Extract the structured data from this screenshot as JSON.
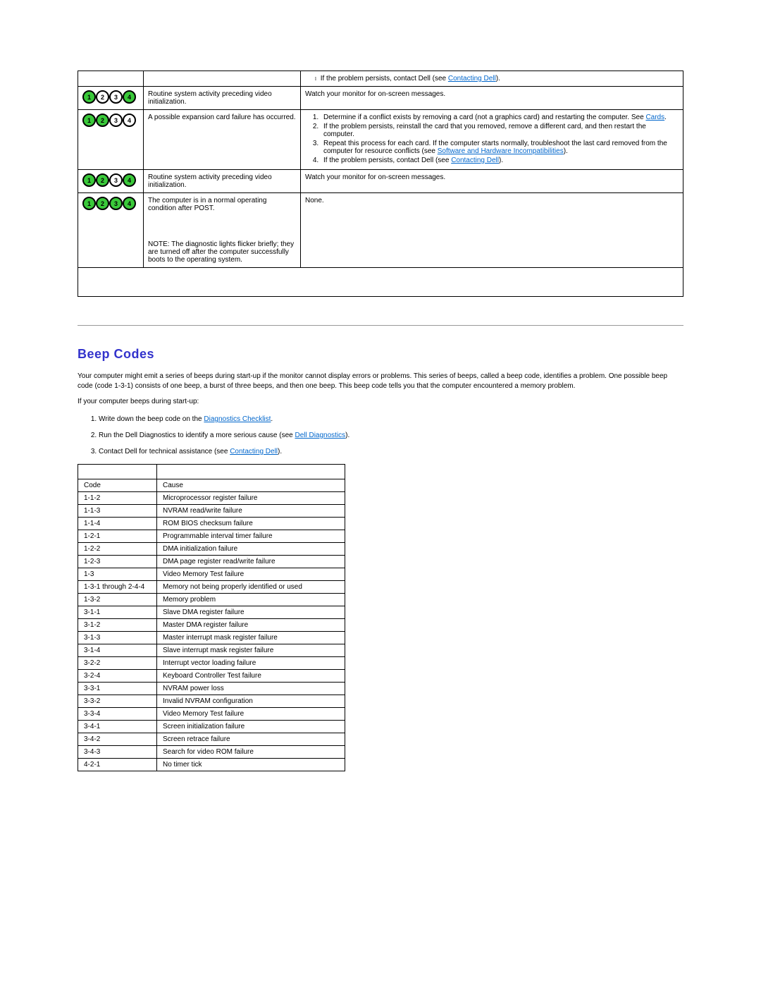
{
  "diag_rows": [
    {
      "pattern": "prev",
      "description": "",
      "solution_type": "bullet_contact"
    },
    {
      "pattern": [
        1,
        0,
        0,
        1
      ],
      "description": "Routine system activity preceding video initialization.",
      "solution_type": "watch_monitor"
    },
    {
      "pattern": [
        1,
        1,
        0,
        0
      ],
      "description": "A possible expansion card failure has occurred.",
      "solution_type": "expansion_steps"
    },
    {
      "pattern": [
        1,
        1,
        0,
        1
      ],
      "description": "Routine system activity preceding video initialization.",
      "solution_type": "watch_monitor"
    },
    {
      "pattern": [
        1,
        1,
        1,
        1
      ],
      "description": "The computer is in a normal operating condition after POST.",
      "note": "NOTE: The diagnostic lights flicker briefly; they are turned off after the computer successfully boots to the operating system.",
      "solution_type": "none"
    }
  ],
  "strings": {
    "watch_monitor": "Watch your monitor for on-screen messages.",
    "none": "None.",
    "contact_dell_prefix": "If the problem persists, contact Dell (see ",
    "contact_dell_link": "Contacting Dell",
    "contact_dell_suffix": ").",
    "exp1_a": "Determine if a conflict exists by removing a card (not a graphics card) and restarting the computer. See ",
    "exp1_link": "Cards",
    "exp1_b": ".",
    "exp2": "If the problem persists, reinstall the card that you removed, remove a different card, and then restart the computer.",
    "exp3_a": "Repeat this process for each card. If the computer starts normally, troubleshoot the last card removed from the computer for resource conflicts (see ",
    "exp3_link": "Software and Hardware Incompatibilities",
    "exp3_b": ").",
    "exp4_a": "If the problem persists, contact Dell (see ",
    "exp4_link": "Contacting Dell",
    "exp4_b": ")."
  },
  "beep_section": {
    "title": "Beep Codes",
    "intro": "Your computer might emit a series of beeps during start-up if the monitor cannot display errors or problems. This series of beeps, called a beep code, identifies a problem. One possible beep code (code 1-3-1) consists of one beep, a burst of three beeps, and then one beep. This beep code tells you that the computer encountered a memory problem.",
    "if_beeps": "If your computer beeps during start-up:",
    "steps": [
      {
        "a": "Write down the beep code on the ",
        "link": "Diagnostics Checklist",
        "b": "."
      },
      {
        "a": "Run the Dell Diagnostics to identify a more serious cause (see ",
        "link": "Dell Diagnostics",
        "b": ")."
      },
      {
        "a": "Contact Dell for technical assistance (see ",
        "link": "Contacting Dell",
        "b": ")."
      }
    ],
    "table_headers": {
      "code": "Code",
      "cause": "Cause"
    },
    "rows": [
      {
        "code": "1-1-2",
        "cause": "Microprocessor register failure"
      },
      {
        "code": "1-1-3",
        "cause": "NVRAM read/write failure"
      },
      {
        "code": "1-1-4",
        "cause": "ROM BIOS checksum failure"
      },
      {
        "code": "1-2-1",
        "cause": "Programmable interval timer failure"
      },
      {
        "code": "1-2-2",
        "cause": "DMA initialization failure"
      },
      {
        "code": "1-2-3",
        "cause": "DMA page register read/write failure"
      },
      {
        "code": "1-3",
        "cause": "Video Memory Test failure"
      },
      {
        "code": "1-3-1 through 2-4-4",
        "cause": "Memory not being properly identified or used"
      },
      {
        "code": "1-3-2",
        "cause": "Memory problem"
      },
      {
        "code": "3-1-1",
        "cause": "Slave DMA register failure"
      },
      {
        "code": "3-1-2",
        "cause": "Master DMA register failure"
      },
      {
        "code": "3-1-3",
        "cause": "Master interrupt mask register failure"
      },
      {
        "code": "3-1-4",
        "cause": "Slave interrupt mask register failure"
      },
      {
        "code": "3-2-2",
        "cause": "Interrupt vector loading failure"
      },
      {
        "code": "3-2-4",
        "cause": "Keyboard Controller Test failure"
      },
      {
        "code": "3-3-1",
        "cause": "NVRAM power loss"
      },
      {
        "code": "3-3-2",
        "cause": "Invalid NVRAM configuration"
      },
      {
        "code": "3-3-4",
        "cause": "Video Memory Test failure"
      },
      {
        "code": "3-4-1",
        "cause": "Screen initialization failure"
      },
      {
        "code": "3-4-2",
        "cause": "Screen retrace failure"
      },
      {
        "code": "3-4-3",
        "cause": "Search for video ROM failure"
      },
      {
        "code": "4-2-1",
        "cause": "No timer tick"
      }
    ]
  }
}
